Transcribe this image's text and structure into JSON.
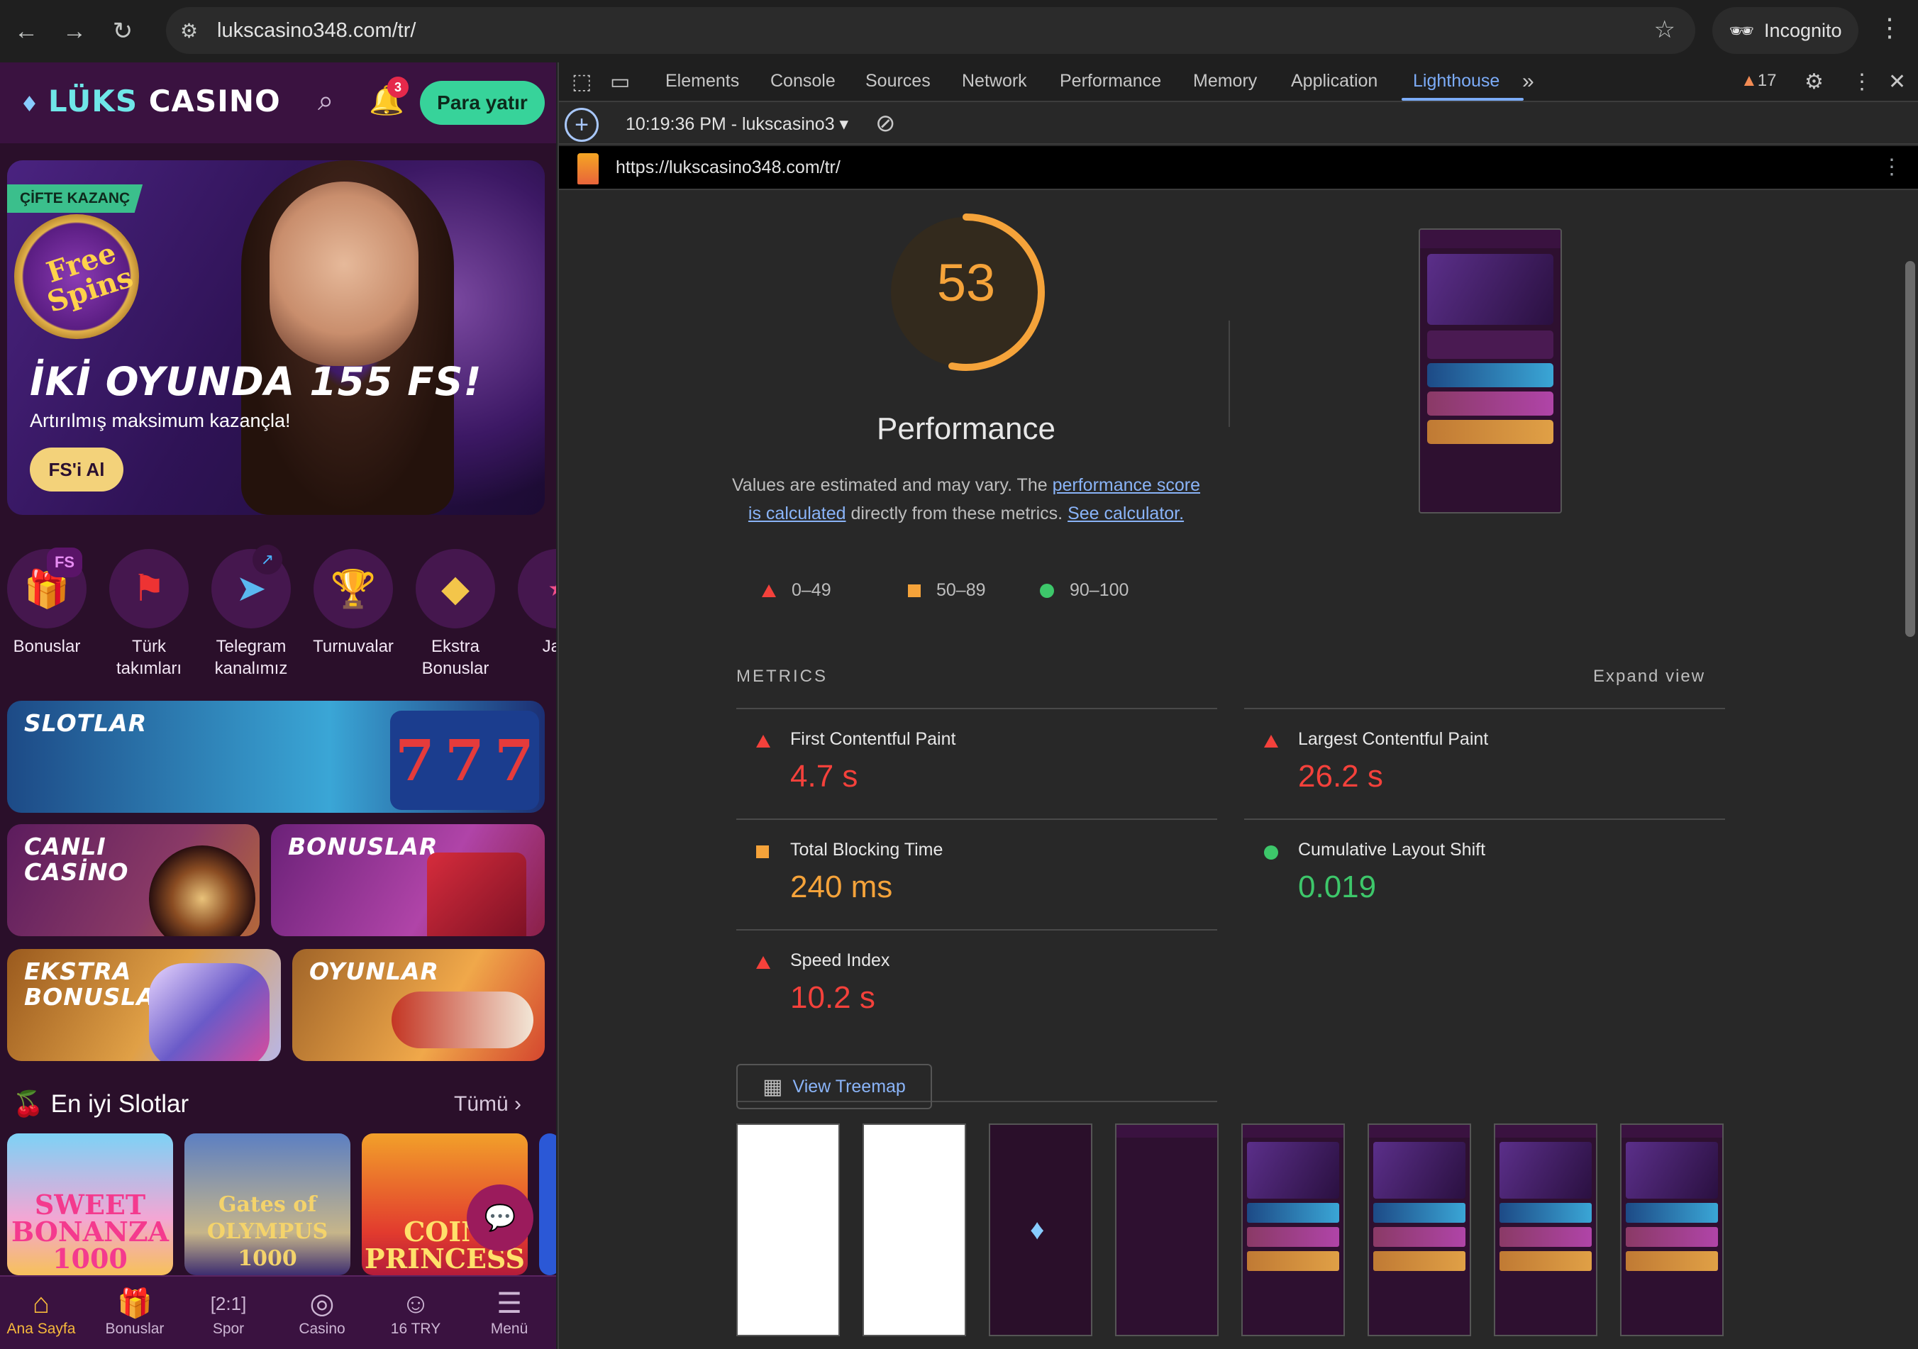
{
  "browser": {
    "url": "lukscasino348.com/tr/",
    "incognito_label": "Incognito"
  },
  "site": {
    "logo_luks": "LÜKS",
    "logo_casino": "CASINO",
    "notification_count": "3",
    "deposit_label": "Para yatır",
    "hero": {
      "tag": "ÇİFTE KAZANÇ",
      "spins_badge": "Free Spins",
      "title": "İKİ OYUNDA 155 FS!",
      "subtitle": "Artırılmış maksimum kazançla!",
      "button": "FS'i Al"
    },
    "quick_links": [
      {
        "label": "Bonuslar",
        "icon": "gift-icon",
        "badge": "FS"
      },
      {
        "label": "Türk takımları",
        "icon": "turkey-flag-icon"
      },
      {
        "label": "Telegram kanalımız",
        "icon": "telegram-icon"
      },
      {
        "label": "Turnuvalar",
        "icon": "trophy-icon"
      },
      {
        "label": "Ekstra Bonuslar",
        "icon": "diamond-icon"
      },
      {
        "label": "Jacl",
        "icon": "jackpot-icon"
      }
    ],
    "tiles": {
      "slotlar": "SLOTLAR",
      "canli_casino": "CANLI CASİNO",
      "bonuslar": "BONUSLAR",
      "ekstra_bonuslar": "EKSTRA BONUSLAR",
      "oyunlar": "OYUNLAR"
    },
    "section_title": "En iyi Slotlar",
    "section_all": "Tümü",
    "games": [
      "SWEET BONANZA 1000",
      "Gates of OLYMPUS 1000",
      "COIN PRINCESS"
    ],
    "bottom_nav": [
      {
        "label": "Ana Sayfa",
        "icon": "home-icon",
        "active": true
      },
      {
        "label": "Bonuslar",
        "icon": "gift-icon"
      },
      {
        "label": "Spor",
        "icon": "scoreboard-icon"
      },
      {
        "label": "Casino",
        "icon": "roulette-icon"
      },
      {
        "label": "16 TRY",
        "icon": "account-icon"
      },
      {
        "label": "Menü",
        "icon": "menu-icon"
      }
    ]
  },
  "devtools": {
    "tabs": [
      "Elements",
      "Console",
      "Sources",
      "Network",
      "Performance",
      "Memory",
      "Application",
      "Lighthouse"
    ],
    "active_tab": "Lighthouse",
    "warning_count": "17",
    "report_label": "10:19:36 PM - lukscasino3",
    "report_url": "https://lukscasino348.com/tr/",
    "score": "53",
    "category": "Performance",
    "desc_prefix": "Values are estimated and may vary. The ",
    "desc_link1": "performance score is calculated",
    "desc_mid": " directly from these metrics. ",
    "desc_link2": "See calculator.",
    "legend": [
      {
        "range": "0–49",
        "color": "#f4413b"
      },
      {
        "range": "50–89",
        "color": "#f5a33a"
      },
      {
        "range": "90–100",
        "color": "#3dc76a"
      }
    ],
    "metrics_label": "METRICS",
    "expand_label": "Expand view",
    "metrics": [
      {
        "name": "First Contentful Paint",
        "value": "4.7 s",
        "rating": "fail"
      },
      {
        "name": "Largest Contentful Paint",
        "value": "26.2 s",
        "rating": "fail"
      },
      {
        "name": "Total Blocking Time",
        "value": "240 ms",
        "rating": "average"
      },
      {
        "name": "Cumulative Layout Shift",
        "value": "0.019",
        "rating": "pass"
      },
      {
        "name": "Speed Index",
        "value": "10.2 s",
        "rating": "fail"
      }
    ],
    "treemap_label": "View Treemap",
    "score_fraction": 0.53
  }
}
